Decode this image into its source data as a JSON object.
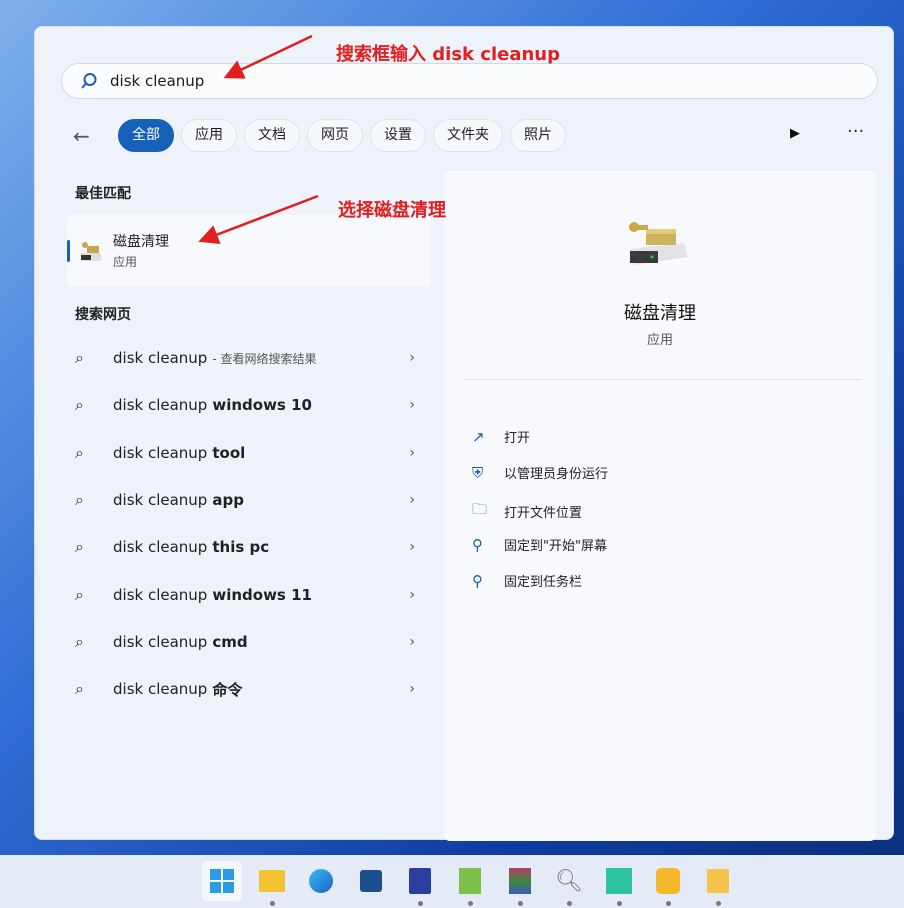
{
  "search": {
    "value": "disk cleanup"
  },
  "tabs": [
    "全部",
    "应用",
    "文档",
    "网页",
    "设置",
    "文件夹",
    "照片"
  ],
  "best_match": {
    "heading": "最佳匹配",
    "title": "磁盘清理",
    "subtitle": "应用"
  },
  "web": {
    "heading": "搜索网页",
    "items": [
      {
        "base": "disk cleanup",
        "bold": "",
        "note": "- 查看网络搜索结果"
      },
      {
        "base": "disk cleanup",
        "bold": "windows 10",
        "note": ""
      },
      {
        "base": "disk cleanup",
        "bold": "tool",
        "note": ""
      },
      {
        "base": "disk cleanup",
        "bold": "app",
        "note": ""
      },
      {
        "base": "disk cleanup",
        "bold": "this pc",
        "note": ""
      },
      {
        "base": "disk cleanup",
        "bold": "windows 11",
        "note": ""
      },
      {
        "base": "disk cleanup",
        "bold": "cmd",
        "note": ""
      },
      {
        "base": "disk cleanup",
        "bold": "命令",
        "note": ""
      }
    ]
  },
  "detail": {
    "title": "磁盘清理",
    "subtitle": "应用",
    "actions": [
      {
        "icon": "open-icon",
        "label": "打开"
      },
      {
        "icon": "admin-shield-icon",
        "label": "以管理员身份运行"
      },
      {
        "icon": "folder-icon",
        "label": "打开文件位置"
      },
      {
        "icon": "pin-icon",
        "label": "固定到\"开始\"屏幕"
      },
      {
        "icon": "pin-icon",
        "label": "固定到任务栏"
      }
    ]
  },
  "annotations": {
    "a1": "搜索框输入 disk cleanup",
    "a2": "选择磁盘清理"
  },
  "colors": {
    "accent": "#1762b8",
    "annotation": "#e02020"
  }
}
